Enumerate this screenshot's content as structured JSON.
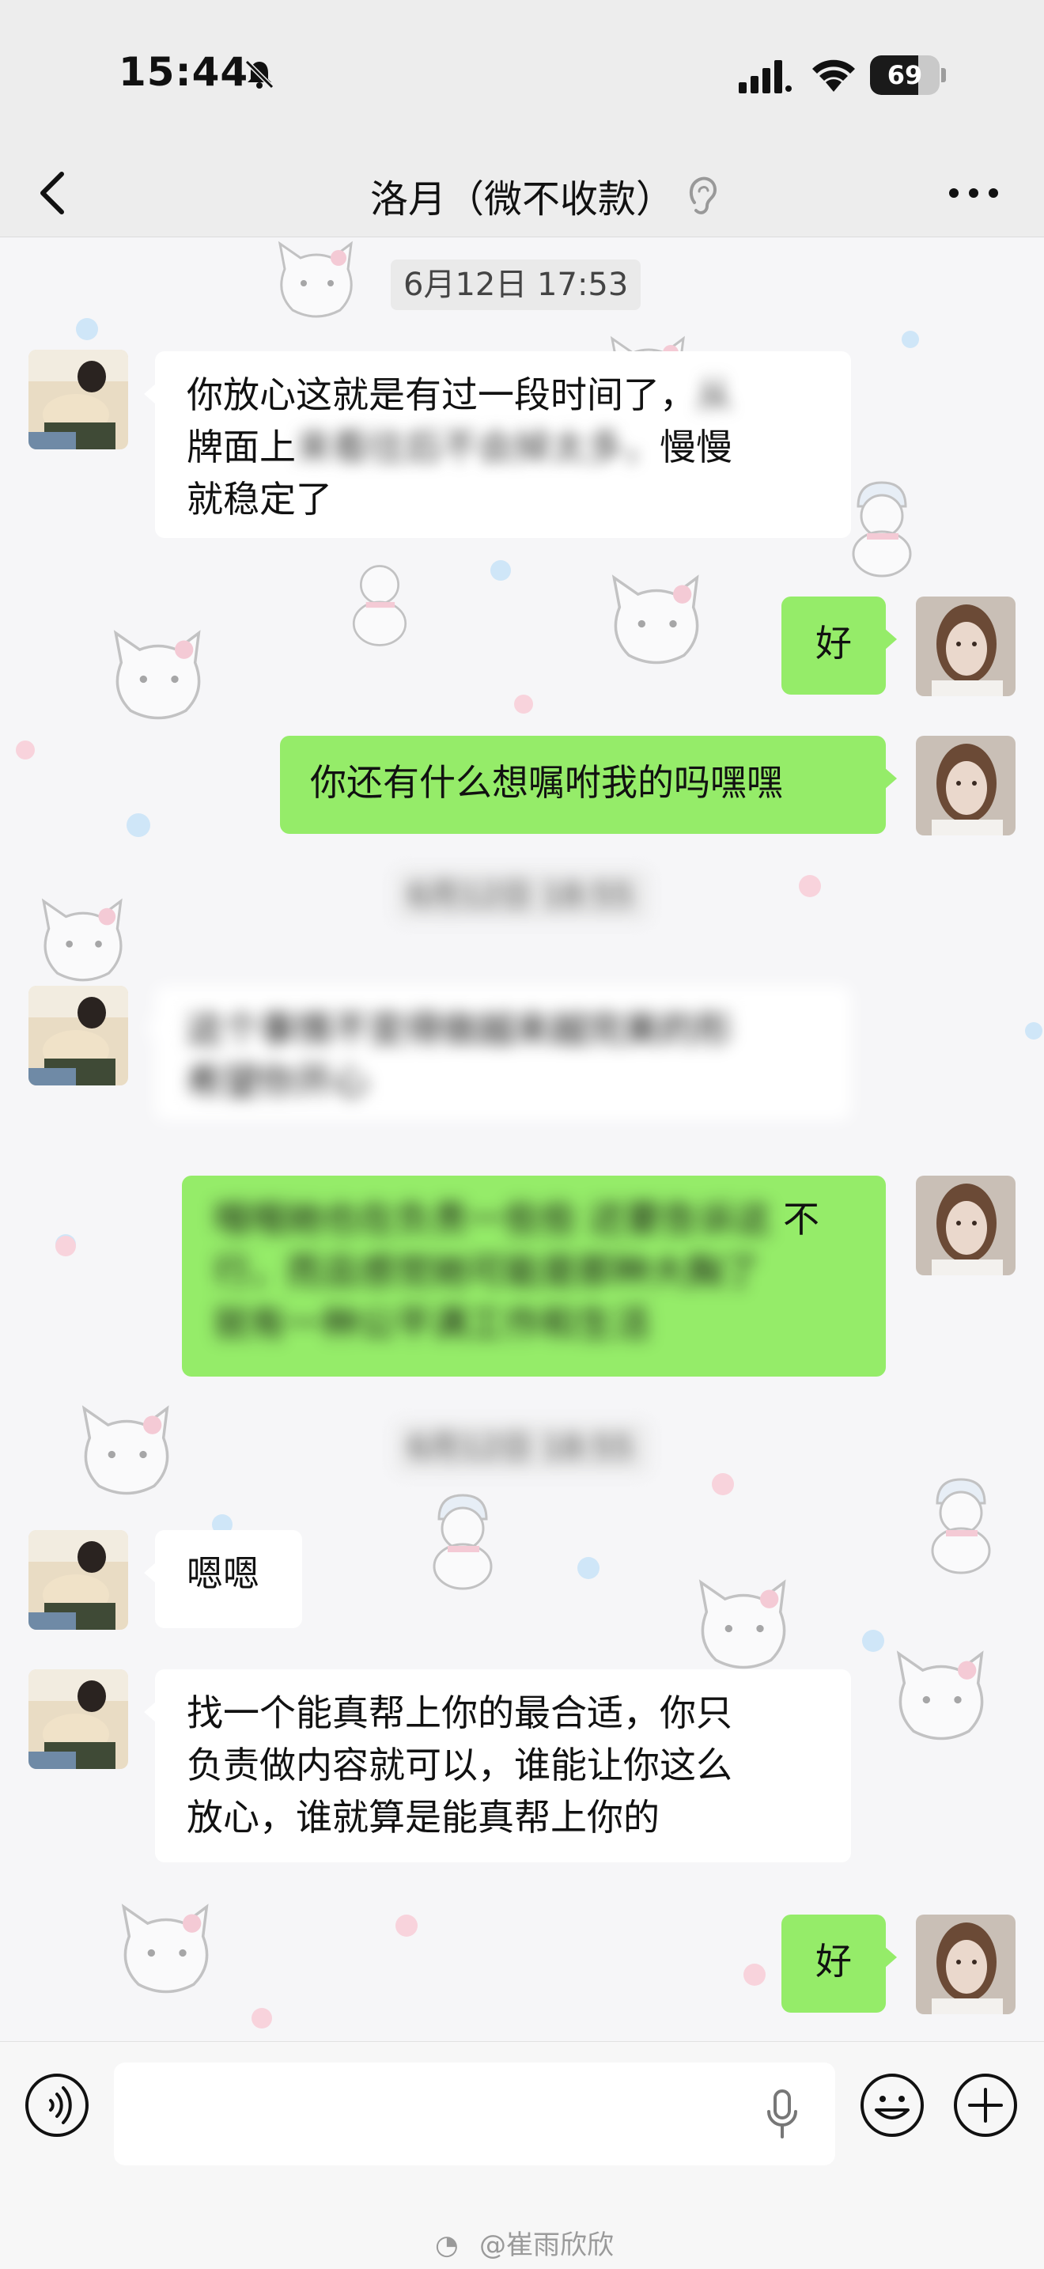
{
  "status_bar": {
    "time": "15:44",
    "battery": "69",
    "battery_level": 0.69
  },
  "header": {
    "title": "洛月（微不收款）",
    "icons": [
      "back-chevron-icon",
      "ear-icon",
      "more-dots-icon"
    ]
  },
  "messages": {
    "ts1": "6月12日 17:53",
    "m1_line1": "你放心这就是有过一段时间了，",
    "m1_line2a": "牌面上",
    "m1_line2b": "慢慢",
    "m1_line3": "就稳定了",
    "m2": "好",
    "m3": "你还有什么想嘱咐我的吗嘿嘿",
    "m6_tail": "不",
    "m7": "嗯嗯",
    "m8_line1": "找一个能真帮上你的最合适，你只",
    "m8_line2": "负责做内容就可以，谁能让你这么",
    "m8_line3": "放心，谁就算是能真帮上你的",
    "m9": "好"
  },
  "watermark": "@崔雨欣欣",
  "colors": {
    "sent_bubble": "#95ec69",
    "received_bubble": "#ffffff",
    "bar_bg": "#ededed"
  }
}
